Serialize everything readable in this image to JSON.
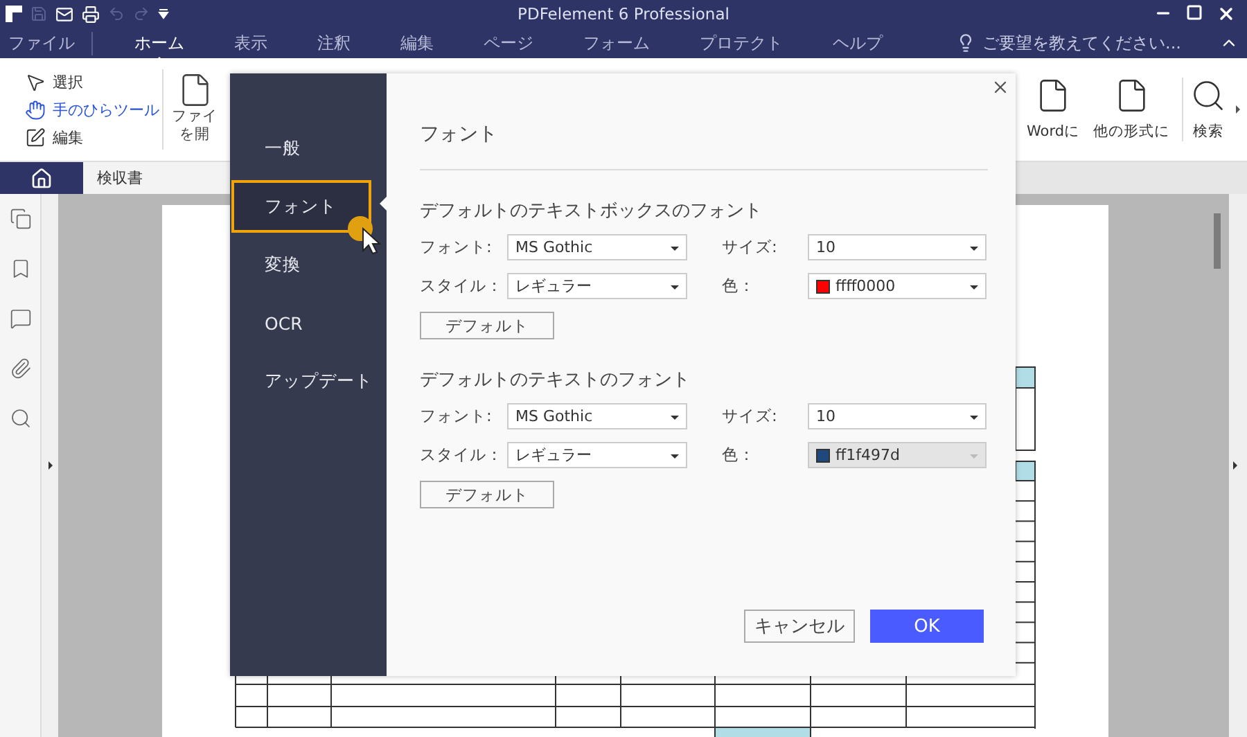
{
  "title_bar": {
    "title": "PDFelement 6 Professional"
  },
  "menu": [
    {
      "label": "ファイル",
      "selected": false
    },
    {
      "label": "ホーム",
      "selected": true
    },
    {
      "label": "表示",
      "selected": false
    },
    {
      "label": "注釈",
      "selected": false
    },
    {
      "label": "編集",
      "selected": false
    },
    {
      "label": "ページ",
      "selected": false
    },
    {
      "label": "フォーム",
      "selected": false
    },
    {
      "label": "プロテクト",
      "selected": false
    },
    {
      "label": "ヘルプ",
      "selected": false
    }
  ],
  "tell_me": {
    "placeholder": "ご要望を教えてください..."
  },
  "ribbon": {
    "tools": [
      {
        "kind": "select",
        "label": "選択",
        "selected": false
      },
      {
        "kind": "hand",
        "label": "手のひらツール",
        "selected": true
      },
      {
        "kind": "edit",
        "label": "編集",
        "selected": false
      }
    ],
    "open_file": [
      "ファイ",
      "を開"
    ],
    "actions": [
      {
        "kind": "word",
        "label": "Wordに"
      },
      {
        "kind": "other",
        "label": "他の形式に"
      },
      {
        "kind": "search",
        "label": "検索"
      }
    ]
  },
  "document_tab": {
    "label": "検収書"
  },
  "dialog": {
    "nav": [
      {
        "label": "一般",
        "selected": false
      },
      {
        "label": "フォント",
        "selected": true
      },
      {
        "label": "変換",
        "selected": false
      },
      {
        "label": "OCR",
        "selected": false
      },
      {
        "label": "アップデート",
        "selected": false
      }
    ],
    "title": "フォント",
    "sections": [
      {
        "heading": "デフォルトのテキストボックスのフォント",
        "font": {
          "label": "フォント:",
          "value": "MS Gothic"
        },
        "size": {
          "label": "サイズ:",
          "value": "10"
        },
        "style": {
          "label": "スタイル：",
          "value": "レギュラー"
        },
        "color": {
          "label": "色：",
          "value": "ffff0000",
          "color": "#ff0000",
          "disabled": false
        },
        "button": "デフォルト"
      },
      {
        "heading": "デフォルトのテキストのフォント",
        "font": {
          "label": "フォント:",
          "value": "MS Gothic"
        },
        "size": {
          "label": "サイズ:",
          "value": "10"
        },
        "style": {
          "label": "スタイル：",
          "value": "レギュラー"
        },
        "color": {
          "label": "色：",
          "value": "ff1f497d",
          "color": "#1f497d",
          "disabled": true
        },
        "button": "デフォルト"
      }
    ],
    "cancel": "キャンセル",
    "ok": "OK"
  }
}
